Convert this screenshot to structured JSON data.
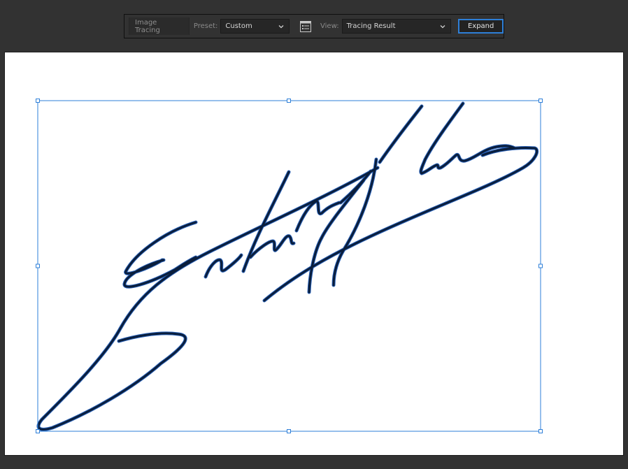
{
  "control_bar": {
    "title": "Image Tracing",
    "preset_label": "Preset:",
    "preset_value": "Custom",
    "panel_icon": "image-trace-panel-icon",
    "view_label": "View:",
    "view_value": "Tracing Result",
    "expand_label": "Expand"
  },
  "colors": {
    "workspace": "#323232",
    "artboard": "#ffffff",
    "selection": "#2e7fd8",
    "trace_stroke": "#0a1e3c",
    "trace_edge": "#2a62b8"
  }
}
